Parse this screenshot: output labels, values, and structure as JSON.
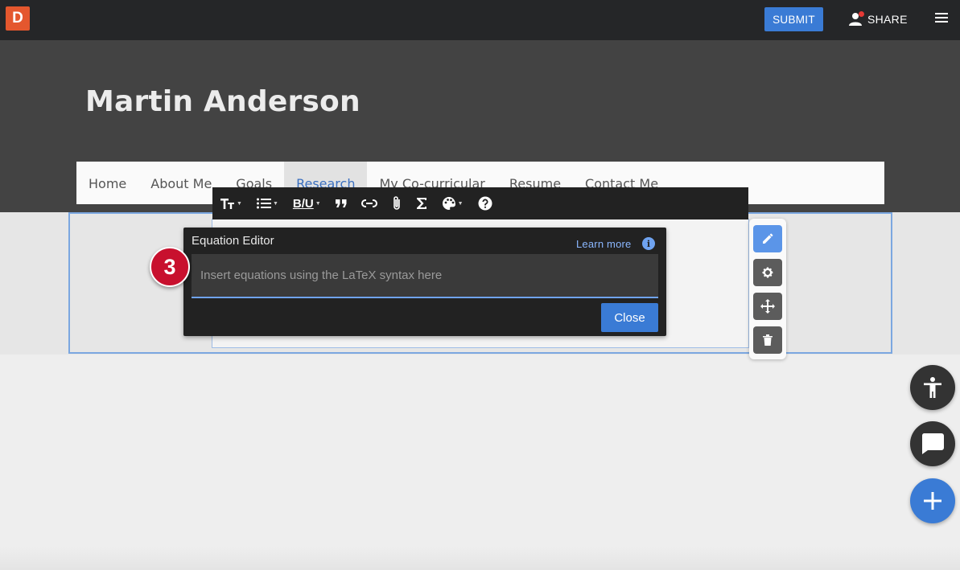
{
  "topbar": {
    "logo_letter": "D",
    "submit_label": "SUBMIT",
    "share_label": "SHARE"
  },
  "header": {
    "site_title": "Martin Anderson"
  },
  "nav": {
    "items": [
      {
        "label": "Home"
      },
      {
        "label": "About Me"
      },
      {
        "label": "Goals"
      },
      {
        "label": "Research",
        "active": true
      },
      {
        "label": "My Co-curricular"
      },
      {
        "label": "Resume"
      },
      {
        "label": "Contact Me"
      }
    ]
  },
  "toolbar": {
    "icons": [
      "text-size-icon",
      "list-icon",
      "bold-underline-icon",
      "quote-icon",
      "link-icon",
      "attachment-icon",
      "sigma-icon",
      "palette-icon",
      "help-icon"
    ],
    "bold_underline_label": "B/U"
  },
  "equation_editor": {
    "title": "Equation Editor",
    "learn_more": "Learn more",
    "input_value": "",
    "input_placeholder": "Insert equations using the LaTeX syntax here",
    "close_label": "Close"
  },
  "step_badge": {
    "number": "3"
  },
  "side_tools": [
    "pencil-icon",
    "gear-icon",
    "move-icon",
    "trash-icon"
  ],
  "colors": {
    "accent": "#3a7bd5",
    "topbar": "#252628",
    "header": "#434343",
    "badge": "#c8102e",
    "logo": "#e4572e"
  }
}
